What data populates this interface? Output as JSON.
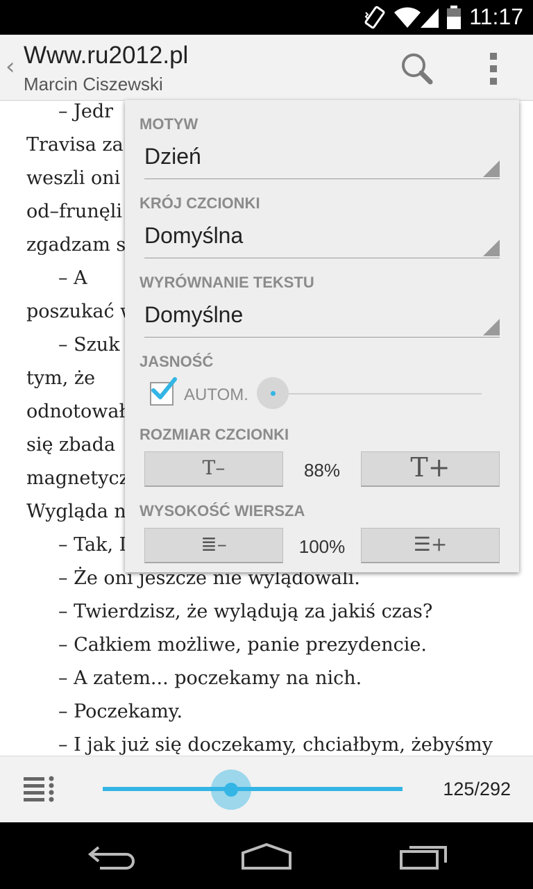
{
  "status_bar": {
    "time": "11:17",
    "icons": [
      "vibrate-icon",
      "wifi-icon",
      "signal-icon",
      "battery-icon"
    ]
  },
  "action_bar": {
    "title": "Www.ru2012.pl",
    "subtitle": "Marcin Ciszewski",
    "icons": [
      "back-chevron-icon",
      "search-icon",
      "overflow-menu-icon"
    ]
  },
  "book_text": {
    "lines": [
      "–  Jedr",
      "Travisa  za",
      "weszli oni",
      "od–frunęli",
      "zgadzam s",
      "–  A",
      "poszukać w",
      "–  Szuk",
      "tym,    że",
      "odnotował",
      "się   zbada",
      "magnetycz",
      "Wygląda n",
      "– Tak, I",
      "– Że oni jeszcze nie wylądowali.",
      "– Twierdzisz, że wylądują za jakiś czas?",
      "– Całkiem możliwe, panie prezydencie.",
      "– A zatem... poczekamy na nich.",
      "– Poczekamy.",
      "– I jak już się doczekamy, chciałbym, żebyśmy"
    ]
  },
  "settings": {
    "theme": {
      "label": "MOTYW",
      "value": "Dzień"
    },
    "font_face": {
      "label": "KRÓJ CZCIONKI",
      "value": "Domyślna"
    },
    "text_align": {
      "label": "WYRÓWNANIE TEKSTU",
      "value": "Domyślne"
    },
    "brightness": {
      "label": "JASNOŚĆ",
      "auto_label": "AUTOM.",
      "auto_checked": true
    },
    "font_size": {
      "label": "ROZMIAR CZCIONKI",
      "decrease": "T–",
      "increase": "T+",
      "value": "88%"
    },
    "line_height": {
      "label": "WYSOKOŚĆ WIERSZA",
      "decrease": "≣–",
      "increase": "☰+",
      "value": "100%"
    }
  },
  "bottom_bar": {
    "page_count": "125/292",
    "progress_fraction": 0.428
  },
  "nav_bar": {
    "icons": [
      "back-icon",
      "home-icon",
      "recents-icon"
    ]
  },
  "colors": {
    "accent": "#33b5e5",
    "popup_bg": "#eeeeee",
    "label_grey": "#8b8b8b"
  }
}
